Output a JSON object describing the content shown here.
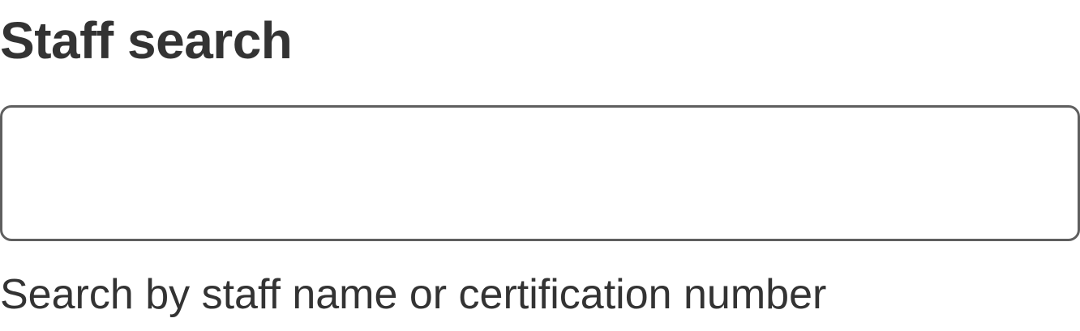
{
  "staff_search": {
    "label": "Staff search",
    "input_value": "",
    "input_placeholder": "",
    "hint": "Search by staff name or certification number"
  }
}
